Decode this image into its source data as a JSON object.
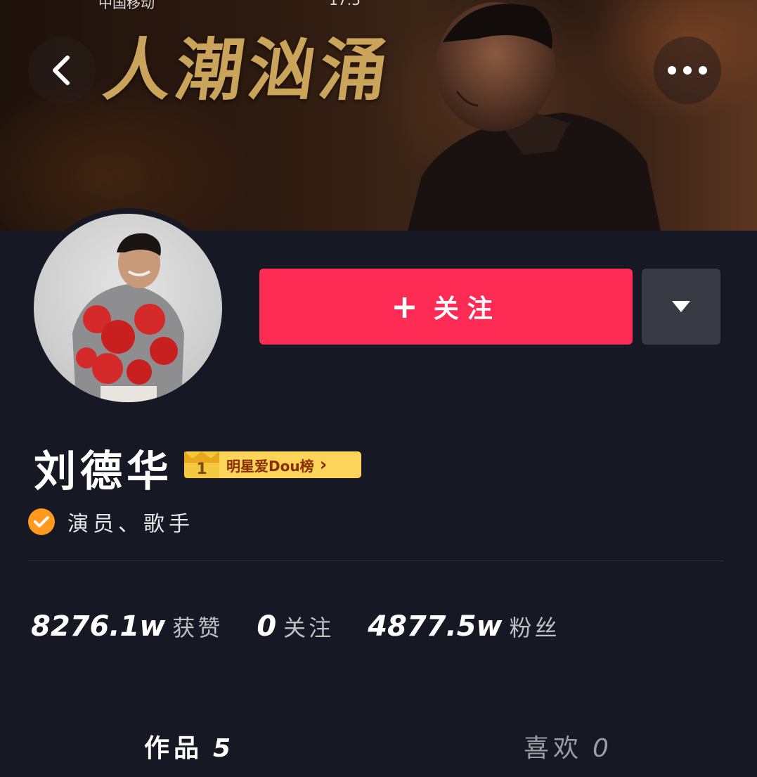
{
  "status_bar": {
    "carrier_fragment": "中国移动",
    "time_fragment": "17:5"
  },
  "banner": {
    "title": "人潮汹涌"
  },
  "profile": {
    "name": "刘德华",
    "rank_badge": {
      "rank": "1",
      "label": "明星爱Dou榜",
      "arrow": "›"
    },
    "verified_role": "演员、歌手"
  },
  "actions": {
    "follow_label": "关注",
    "follow_plus": "+"
  },
  "stats": [
    {
      "value": "8276.1w",
      "label": "获赞"
    },
    {
      "value": "0",
      "label": "关注"
    },
    {
      "value": "4877.5w",
      "label": "粉丝"
    }
  ],
  "tabs": [
    {
      "label": "作品",
      "count": "5",
      "active": true
    },
    {
      "label": "喜欢",
      "count": "0",
      "active": false
    }
  ],
  "colors": {
    "accent": "#fe2c55",
    "background": "#161823",
    "verified": "#ff9a1f"
  },
  "icons": [
    "back-arrow-icon",
    "more-dots-icon",
    "dropdown-triangle-icon",
    "verified-check-icon",
    "crown-icon"
  ]
}
